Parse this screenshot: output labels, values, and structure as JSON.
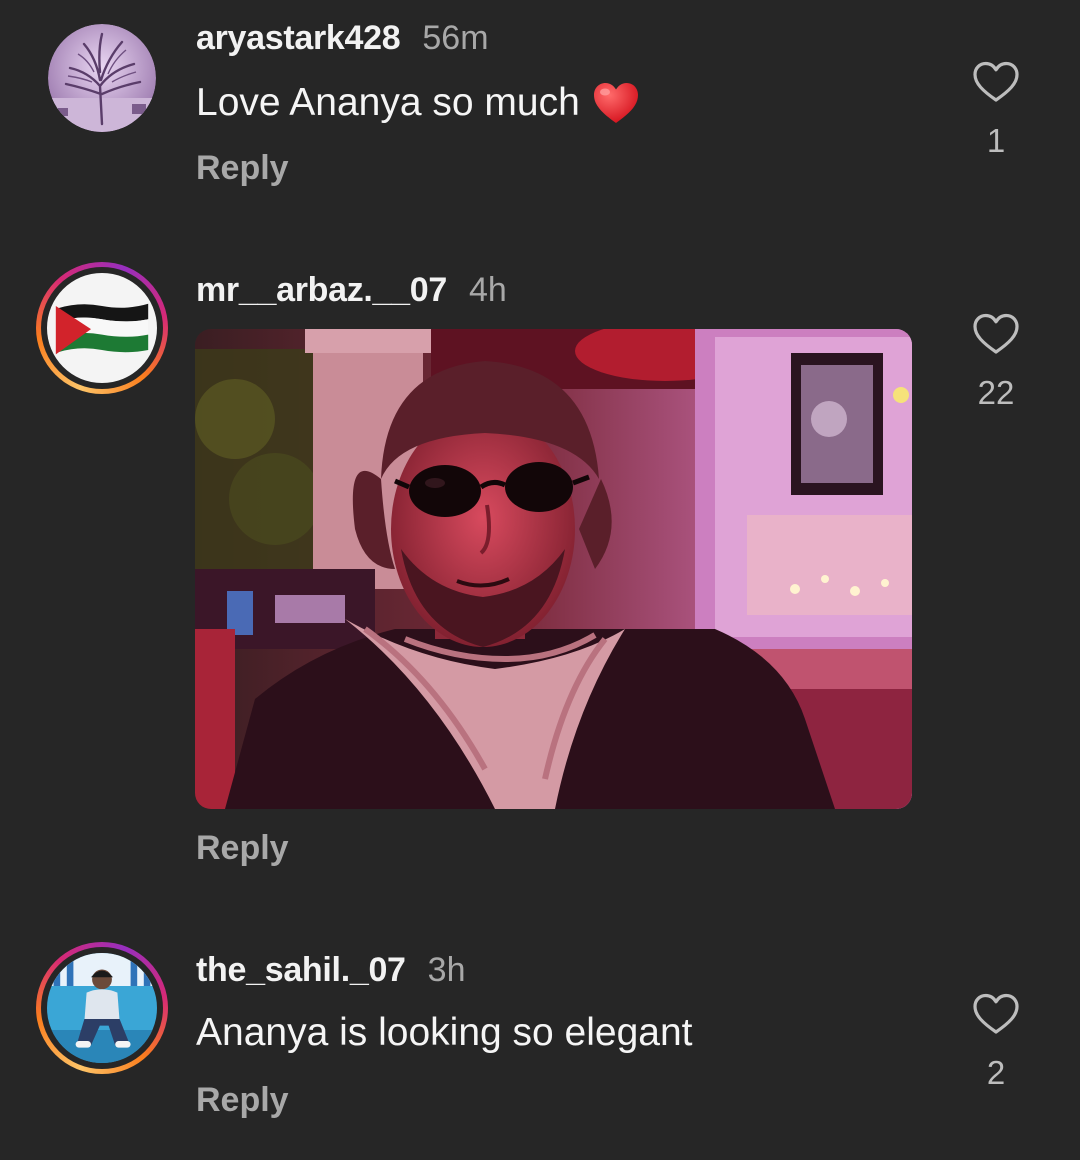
{
  "comments": [
    {
      "username": "aryastark428",
      "time": "56m",
      "text": "Love Ananya so much",
      "emoji": "heart-emoji",
      "reply_label": "Reply",
      "likes": "1",
      "avatar": "tree-avatar",
      "has_story_ring": false
    },
    {
      "username": "mr__arbaz.__07",
      "time": "4h",
      "text": "",
      "attachment": "gif-image",
      "reply_label": "Reply",
      "likes": "22",
      "avatar": "flag-avatar",
      "has_story_ring": true
    },
    {
      "username": "the_sahil._07",
      "time": "3h",
      "text": "Ananya is looking so elegant",
      "reply_label": "Reply",
      "likes": "2",
      "avatar": "person-avatar",
      "has_story_ring": true
    }
  ],
  "icons": {
    "like": "heart-outline-icon"
  },
  "colors": {
    "background": "#262626",
    "secondary_text": "#a8a8a8",
    "emoji_red": "#e8262f"
  }
}
